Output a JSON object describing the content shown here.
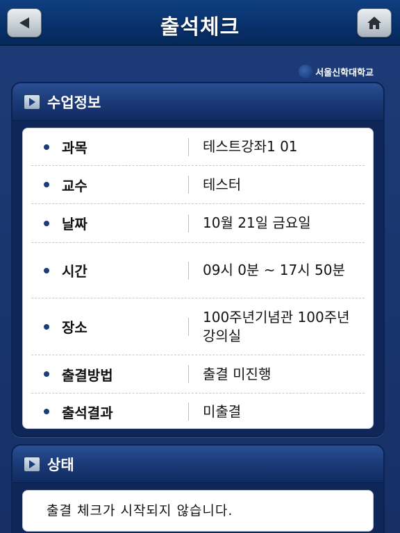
{
  "header": {
    "title": "출석체크",
    "back_icon": "back-arrow-icon",
    "home_icon": "home-icon"
  },
  "logo": {
    "text": "서울신학대학교"
  },
  "class_info": {
    "title": "수업정보",
    "rows": [
      {
        "label": "과목",
        "value": "테스트강좌1 01"
      },
      {
        "label": "교수",
        "value": "테스터"
      },
      {
        "label": "날짜",
        "value": "10월 21일 금요일"
      },
      {
        "label": "시간",
        "value": "09시 0분 ~ 17시 50분"
      },
      {
        "label": "장소",
        "value": "100주년기념관 100주년강의실"
      },
      {
        "label": "출결방법",
        "value": "출결 미진행"
      },
      {
        "label": "출석결과",
        "value": "미출결"
      }
    ]
  },
  "status": {
    "title": "상태",
    "message": "출결 체크가 시작되지 않습니다."
  },
  "colors": {
    "background": "#1a3770",
    "header": "#0a3470",
    "bullet": "#1c3c7a"
  }
}
